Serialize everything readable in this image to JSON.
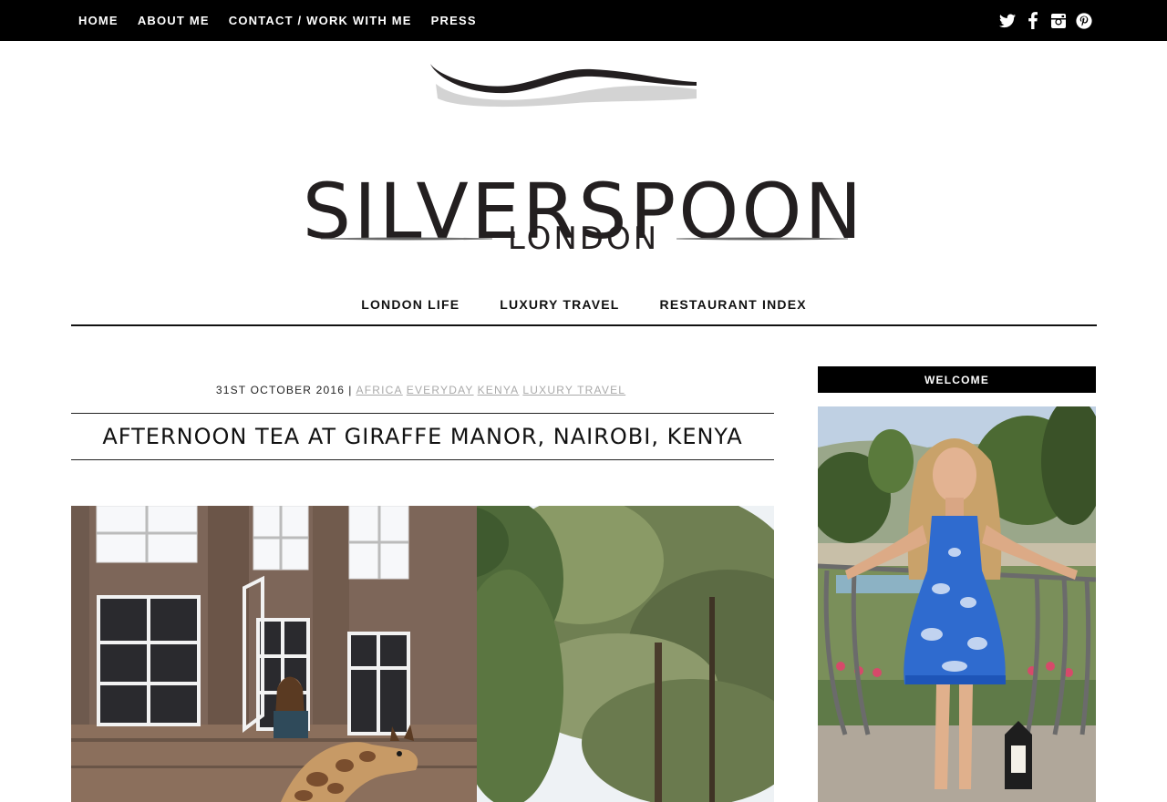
{
  "topnav": {
    "items": [
      "HOME",
      "ABOUT ME",
      "CONTACT / WORK WITH ME",
      "PRESS"
    ]
  },
  "social": {
    "icons": [
      "twitter-icon",
      "facebook-icon",
      "instagram-icon",
      "pinterest-icon"
    ]
  },
  "logo": {
    "title": "SILVERSPOON",
    "subtitle": "LONDON"
  },
  "mainnav": {
    "items": [
      "LONDON LIFE",
      "LUXURY TRAVEL",
      "RESTAURANT INDEX"
    ]
  },
  "post": {
    "date": "31ST OCTOBER 2016",
    "separator": "|",
    "categories": [
      "AFRICA",
      "EVERYDAY",
      "KENYA",
      "LUXURY TRAVEL"
    ],
    "title": "AFTERNOON TEA AT GIRAFFE MANOR, NAIROBI, KENYA"
  },
  "sidebar": {
    "widget_title": "WELCOME"
  },
  "colors": {
    "topbar": "#000000",
    "category_link": "#a9a9a9",
    "text": "#111111"
  }
}
